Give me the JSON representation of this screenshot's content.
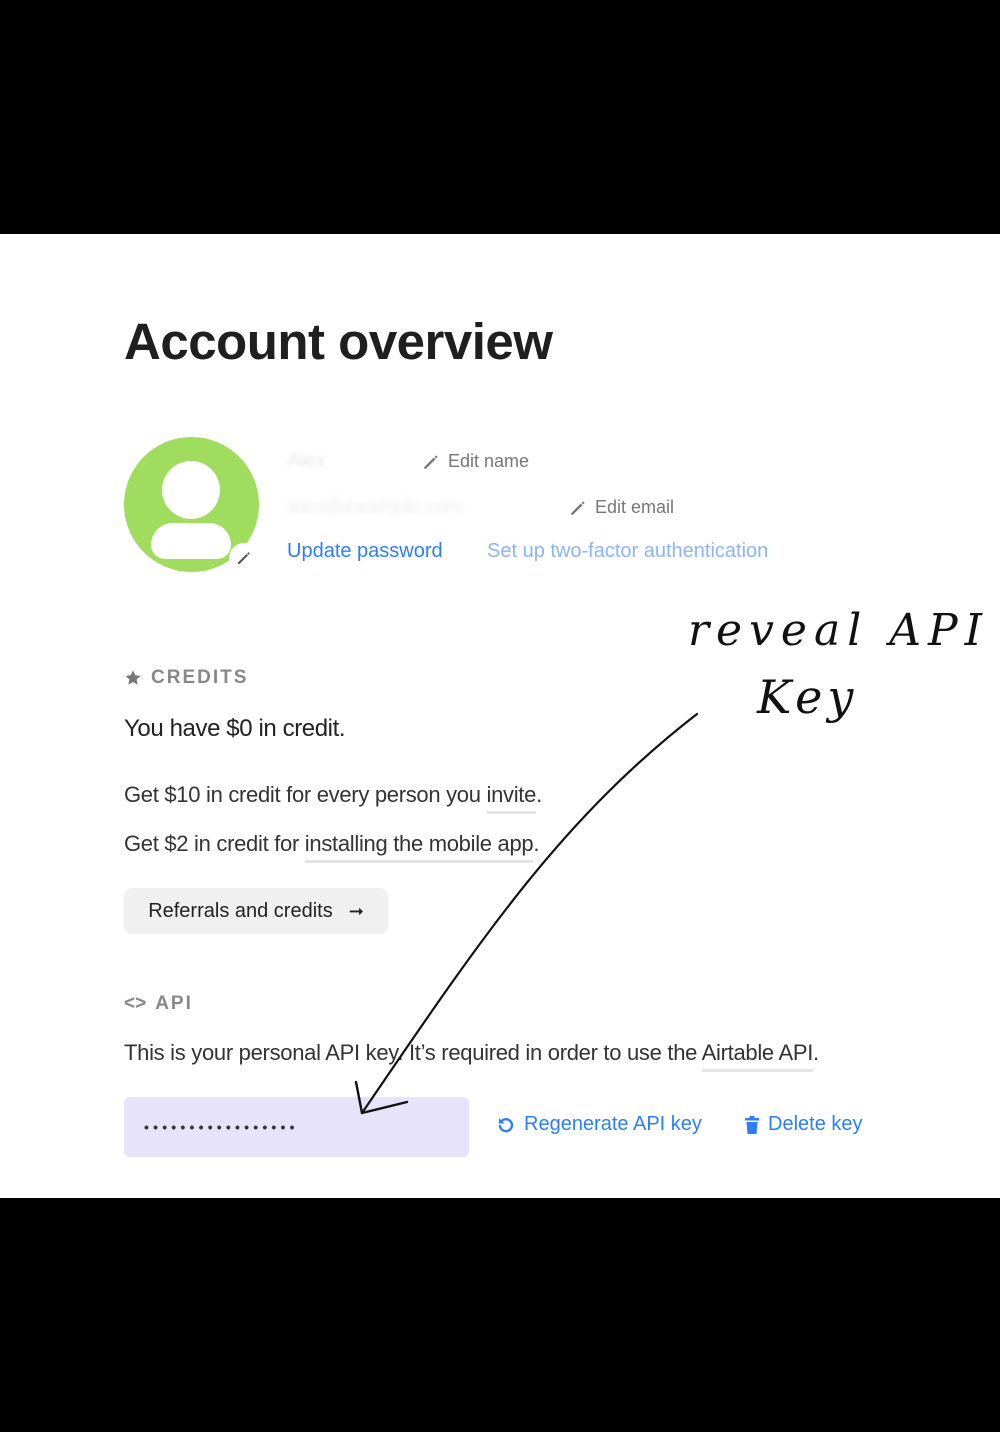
{
  "page": {
    "title": "Account overview"
  },
  "profile": {
    "name": "Alex",
    "email": "alex@example.com",
    "edit_name_label": "Edit name",
    "edit_email_label": "Edit email",
    "update_password_label": "Update password",
    "two_factor_label": "Set up two-factor authentication"
  },
  "credits": {
    "section_label": "CREDITS",
    "balance_text": "You have $0 in credit.",
    "invite_prefix": "Get $10 in credit for every person you ",
    "invite_link": "invite",
    "invite_suffix": ".",
    "mobile_prefix": "Get $2 in credit for ",
    "mobile_link": "installing the mobile app",
    "mobile_suffix": ".",
    "referrals_button": "Referrals and credits",
    "referrals_arrow": "➞"
  },
  "api": {
    "section_label": "API",
    "section_icon_text": "<>",
    "description_prefix": "This is your personal API key. It’s required in order to use the ",
    "description_link": "Airtable API",
    "description_suffix": ".",
    "masked_key": "•••••••••••••••••",
    "regenerate_label": "Regenerate API key",
    "delete_label": "Delete key"
  },
  "annotation": {
    "line1": "reveal API",
    "line2": "Key"
  },
  "colors": {
    "accent": "#2d7ff9",
    "avatar": "#a0dc5e",
    "api_box": "#e7e3fb"
  }
}
